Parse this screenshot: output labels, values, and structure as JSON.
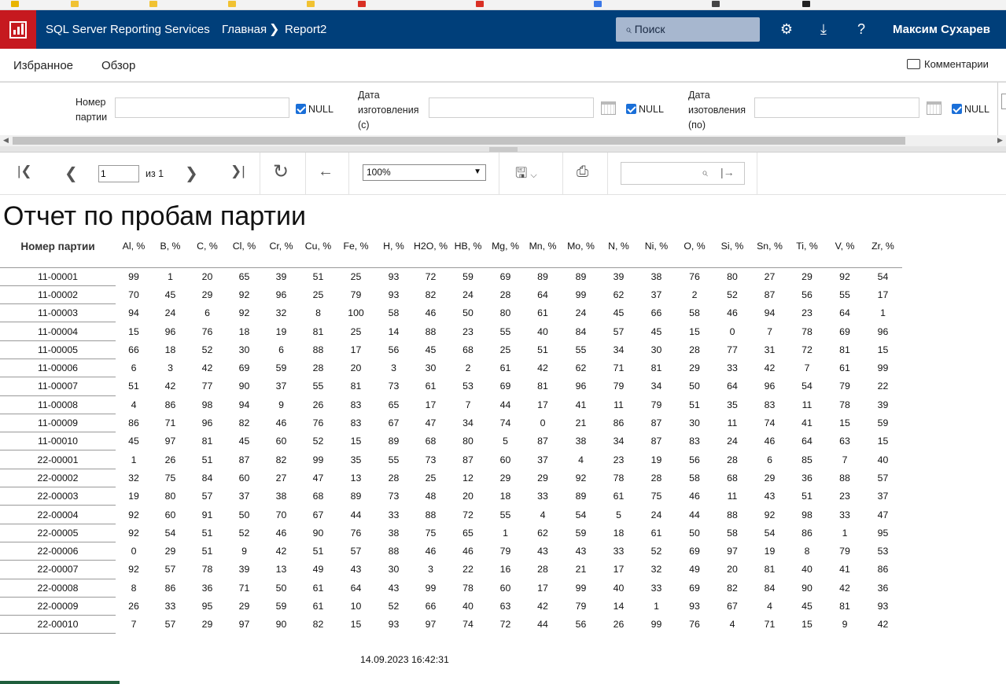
{
  "header": {
    "app_name": "SQL Server Reporting Services",
    "crumb_home": "Главная",
    "crumb_report": "Report2",
    "search_placeholder": "Поиск",
    "user": "Максим Сухарев"
  },
  "nav": {
    "favorites": "Избранное",
    "browse": "Обзор",
    "comments": "Комментарии"
  },
  "params": {
    "lot_label_1": "Номер",
    "lot_label_2": "партии",
    "date_from_1": "Дата",
    "date_from_2": "изготовления",
    "date_from_3": "(с)",
    "date_to_1": "Дата",
    "date_to_2": "изотовления",
    "date_to_3": "(по)",
    "null_label": "NULL"
  },
  "toolbar": {
    "page_value": "1",
    "of_label": "из 1",
    "zoom": "100%"
  },
  "report": {
    "title": "Отчет по пробам партии",
    "lot_header": "Номер партии",
    "columns": [
      "Al, %",
      "B, %",
      "C, %",
      "Cl, %",
      "Cr, %",
      "Cu, %",
      "Fe, %",
      "H, %",
      "H2O, %",
      "HB, %",
      "Mg, %",
      "Mn, %",
      "Mo, %",
      "N, %",
      "Ni, %",
      "O, %",
      "Si, %",
      "Sn, %",
      "Ti, %",
      "V, %",
      "Zr, %"
    ],
    "rows": [
      {
        "lot": "11-00001",
        "values": [
          99,
          1,
          20,
          65,
          39,
          51,
          25,
          93,
          72,
          59,
          69,
          89,
          89,
          39,
          38,
          76,
          80,
          27,
          29,
          92,
          54
        ]
      },
      {
        "lot": "11-00002",
        "values": [
          70,
          45,
          29,
          92,
          96,
          25,
          79,
          93,
          82,
          24,
          28,
          64,
          99,
          62,
          37,
          2,
          52,
          87,
          56,
          55,
          17
        ]
      },
      {
        "lot": "11-00003",
        "values": [
          94,
          24,
          6,
          92,
          32,
          8,
          100,
          58,
          46,
          50,
          80,
          61,
          24,
          45,
          66,
          58,
          46,
          94,
          23,
          64,
          1
        ]
      },
      {
        "lot": "11-00004",
        "values": [
          15,
          96,
          76,
          18,
          19,
          81,
          25,
          14,
          88,
          23,
          55,
          40,
          84,
          57,
          45,
          15,
          0,
          7,
          78,
          69,
          96
        ]
      },
      {
        "lot": "11-00005",
        "values": [
          66,
          18,
          52,
          30,
          6,
          88,
          17,
          56,
          45,
          68,
          25,
          51,
          55,
          34,
          30,
          28,
          77,
          31,
          72,
          81,
          15
        ]
      },
      {
        "lot": "11-00006",
        "values": [
          6,
          3,
          42,
          69,
          59,
          28,
          20,
          3,
          30,
          2,
          61,
          42,
          62,
          71,
          81,
          29,
          33,
          42,
          7,
          61,
          99
        ]
      },
      {
        "lot": "11-00007",
        "values": [
          51,
          42,
          77,
          90,
          37,
          55,
          81,
          73,
          61,
          53,
          69,
          81,
          96,
          79,
          34,
          50,
          64,
          96,
          54,
          79,
          22
        ]
      },
      {
        "lot": "11-00008",
        "values": [
          4,
          86,
          98,
          94,
          9,
          26,
          83,
          65,
          17,
          7,
          44,
          17,
          41,
          11,
          79,
          51,
          35,
          83,
          11,
          78,
          39
        ]
      },
      {
        "lot": "11-00009",
        "values": [
          86,
          71,
          96,
          82,
          46,
          76,
          83,
          67,
          47,
          34,
          74,
          0,
          21,
          86,
          87,
          30,
          11,
          74,
          41,
          15,
          59
        ]
      },
      {
        "lot": "11-00010",
        "values": [
          45,
          97,
          81,
          45,
          60,
          52,
          15,
          89,
          68,
          80,
          5,
          87,
          38,
          34,
          87,
          83,
          24,
          46,
          64,
          63,
          15
        ]
      },
      {
        "lot": "22-00001",
        "values": [
          1,
          26,
          51,
          87,
          82,
          99,
          35,
          55,
          73,
          87,
          60,
          37,
          4,
          23,
          19,
          56,
          28,
          6,
          85,
          7,
          40
        ]
      },
      {
        "lot": "22-00002",
        "values": [
          32,
          75,
          84,
          60,
          27,
          47,
          13,
          28,
          25,
          12,
          29,
          29,
          92,
          78,
          28,
          58,
          68,
          29,
          36,
          88,
          57
        ]
      },
      {
        "lot": "22-00003",
        "values": [
          19,
          80,
          57,
          37,
          38,
          68,
          89,
          73,
          48,
          20,
          18,
          33,
          89,
          61,
          75,
          46,
          11,
          43,
          51,
          23,
          37
        ]
      },
      {
        "lot": "22-00004",
        "values": [
          92,
          60,
          91,
          50,
          70,
          67,
          44,
          33,
          88,
          72,
          55,
          4,
          54,
          5,
          24,
          44,
          88,
          92,
          98,
          33,
          47
        ]
      },
      {
        "lot": "22-00005",
        "values": [
          92,
          54,
          51,
          52,
          46,
          90,
          76,
          38,
          75,
          65,
          1,
          62,
          59,
          18,
          61,
          50,
          58,
          54,
          86,
          1,
          95
        ]
      },
      {
        "lot": "22-00006",
        "values": [
          0,
          29,
          51,
          9,
          42,
          51,
          57,
          88,
          46,
          46,
          79,
          43,
          43,
          33,
          52,
          69,
          97,
          19,
          8,
          79,
          53
        ]
      },
      {
        "lot": "22-00007",
        "values": [
          92,
          57,
          78,
          39,
          13,
          49,
          43,
          30,
          3,
          22,
          16,
          28,
          21,
          17,
          32,
          49,
          20,
          81,
          40,
          41,
          86
        ]
      },
      {
        "lot": "22-00008",
        "values": [
          8,
          86,
          36,
          71,
          50,
          61,
          64,
          43,
          99,
          78,
          60,
          17,
          99,
          40,
          33,
          69,
          82,
          84,
          90,
          42,
          36
        ]
      },
      {
        "lot": "22-00009",
        "values": [
          26,
          33,
          95,
          29,
          59,
          61,
          10,
          52,
          66,
          40,
          63,
          42,
          79,
          14,
          1,
          93,
          67,
          4,
          45,
          81,
          93
        ]
      },
      {
        "lot": "22-00010",
        "values": [
          7,
          57,
          29,
          97,
          90,
          82,
          15,
          93,
          97,
          74,
          72,
          44,
          56,
          26,
          99,
          76,
          4,
          71,
          15,
          9,
          42
        ]
      }
    ],
    "timestamp": "14.09.2023 16:42:31"
  },
  "colors": {
    "header_bg": "#003f7a",
    "logo_bg": "#c6191f",
    "checkbox": "#1a6fd8"
  }
}
